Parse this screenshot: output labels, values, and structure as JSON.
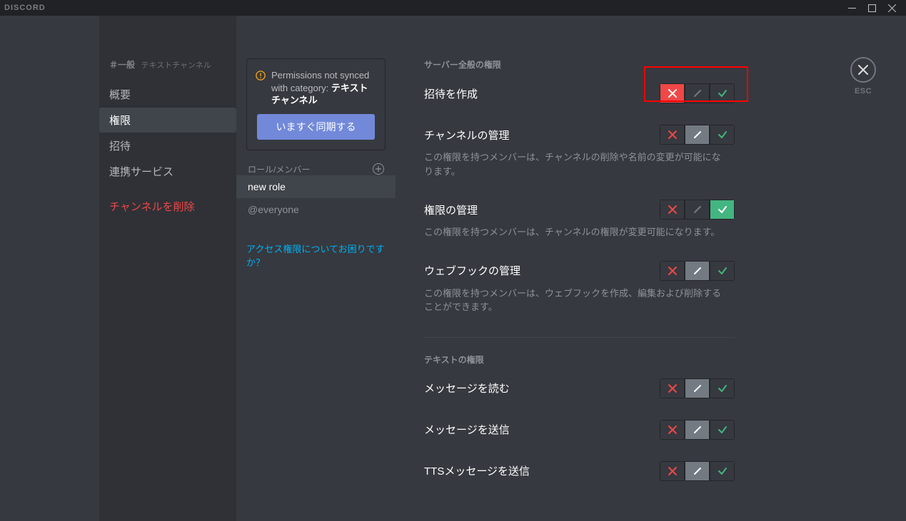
{
  "brand": "DISCORD",
  "sidebar": {
    "crumb_channel": "＃一般",
    "crumb_type": "テキストチャンネル",
    "items": [
      {
        "label": "概要",
        "active": false
      },
      {
        "label": "権限",
        "active": true
      },
      {
        "label": "招待",
        "active": false
      },
      {
        "label": "連携サービス",
        "active": false
      }
    ],
    "delete_label": "チャンネルを削除"
  },
  "mid": {
    "notice_pre": "Permissions not synced with category: ",
    "notice_bold": "テキストチャンネル",
    "sync_button": "いますぐ同期する",
    "roles_header": "ロール/メンバー",
    "roles": [
      {
        "label": "new role",
        "selected": true
      },
      {
        "label": "@everyone",
        "selected": false
      }
    ],
    "help_link": "アクセス権限についてお困りですか？"
  },
  "main": {
    "sections": {
      "server": "サーバー全般の権限",
      "text": "テキストの権限"
    },
    "perms": {
      "create_invite": {
        "label": "招待を作成",
        "value": "deny"
      },
      "manage_channel": {
        "label": "チャンネルの管理",
        "desc": "この権限を持つメンバーは、チャンネルの削除や名前の変更が可能になります。",
        "value": "pass"
      },
      "manage_perms": {
        "label": "権限の管理",
        "desc": "この権限を持つメンバーは、チャンネルの権限が変更可能になります。",
        "value": "allow"
      },
      "manage_webhooks": {
        "label": "ウェブフックの管理",
        "desc": "この権限を持つメンバーは、ウェブフックを作成、編集および削除することができます。",
        "value": "pass"
      },
      "read_messages": {
        "label": "メッセージを読む",
        "value": "pass"
      },
      "send_messages": {
        "label": "メッセージを送信",
        "value": "pass"
      },
      "send_tts": {
        "label": "TTSメッセージを送信",
        "value": "pass"
      }
    }
  },
  "close": {
    "esc": "ESC"
  }
}
